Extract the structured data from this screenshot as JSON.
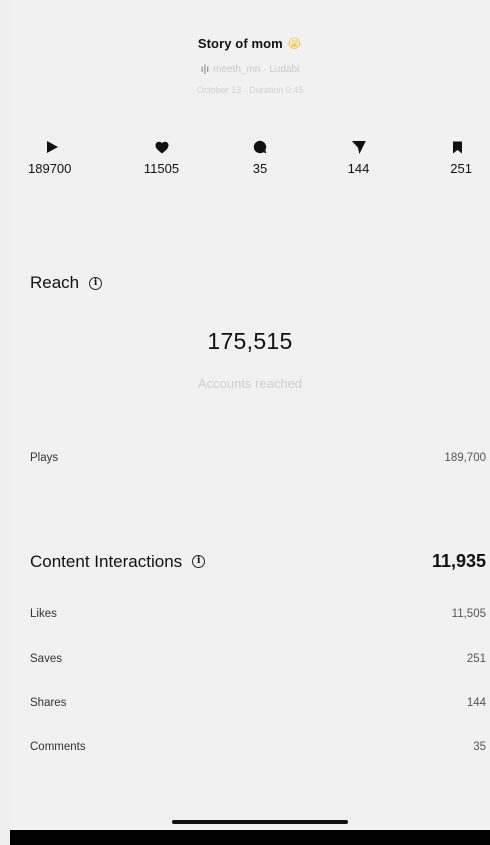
{
  "header": {
    "title": "Story of mom",
    "title_emoji": "😭",
    "audio_icon": "waveform-icon",
    "audio_text": "meeth_mn · Ludabi",
    "date_text": "October 13 · Duration 0:45"
  },
  "stats": [
    {
      "icon": "play-icon",
      "value": "189700"
    },
    {
      "icon": "heart-icon",
      "value": "11505"
    },
    {
      "icon": "comment-icon",
      "value": "35"
    },
    {
      "icon": "share-icon",
      "value": "144"
    },
    {
      "icon": "bookmark-icon",
      "value": "251"
    }
  ],
  "reach": {
    "heading": "Reach",
    "info_icon": "info-icon",
    "accounts_reached": "175,515",
    "accounts_reached_label": "Accounts reached",
    "plays_label": "Plays",
    "plays_value": "189,700"
  },
  "content_interactions": {
    "heading": "Content Interactions",
    "total": "11,935",
    "rows": [
      {
        "label": "Likes",
        "value": "11,505"
      },
      {
        "label": "Saves",
        "value": "251"
      },
      {
        "label": "Shares",
        "value": "144"
      },
      {
        "label": "Comments",
        "value": "35"
      }
    ]
  }
}
